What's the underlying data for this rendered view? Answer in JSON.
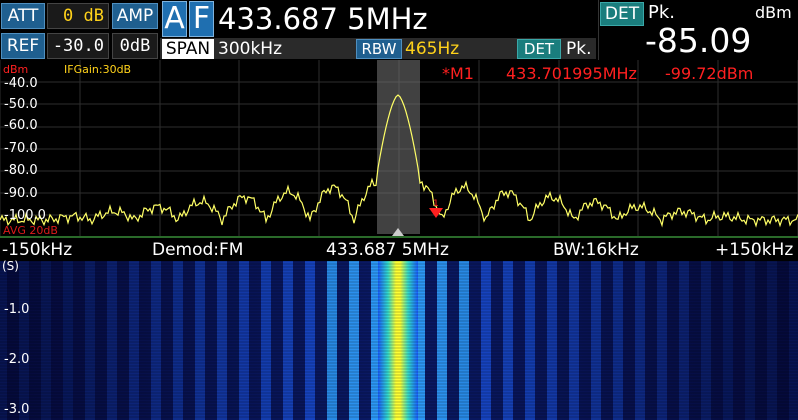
{
  "header": {
    "att_label": "ATT",
    "att_value": "0 dB",
    "amp_label": "AMP",
    "amp_value": "0dB",
    "ref_label": "REF",
    "ref_value": "-30.0",
    "mode_a": "A",
    "mode_f": "F",
    "center_freq": "433.687 5MHz",
    "span_label": "SPAN",
    "span_value": "300kHz",
    "rbw_label": "RBW",
    "rbw_value": "465Hz",
    "det_label": "DET",
    "det_value": "Pk.",
    "readout_det_label": "DET",
    "readout_det_value": "Pk.",
    "readout_unit": "dBm",
    "readout_value": "-85.09"
  },
  "spectrum": {
    "unit": "dBm",
    "if_gain": "IFGain:30dB",
    "marker_text": "*M1",
    "marker_freq": "433.701995MHz",
    "marker_level": "-99.72dBm",
    "avg_text": "AVG 20dB",
    "y_ticks": [
      "-40.0",
      "-50.0",
      "-60.0",
      "-70.0",
      "-80.0",
      "-90.0",
      "-100.0"
    ],
    "colors": {
      "trace": "#ffff66",
      "grid": "#333333",
      "marker": "#ff2020"
    }
  },
  "freq_axis": {
    "left": "-150kHz",
    "demod": "Demod:FM",
    "center": "433.687 5MHz",
    "bw": "BW:16kHz",
    "right": "+150kHz"
  },
  "waterfall": {
    "unit": "(S)",
    "y_ticks": [
      "-1.0",
      "-2.0",
      "-3.0"
    ]
  }
}
